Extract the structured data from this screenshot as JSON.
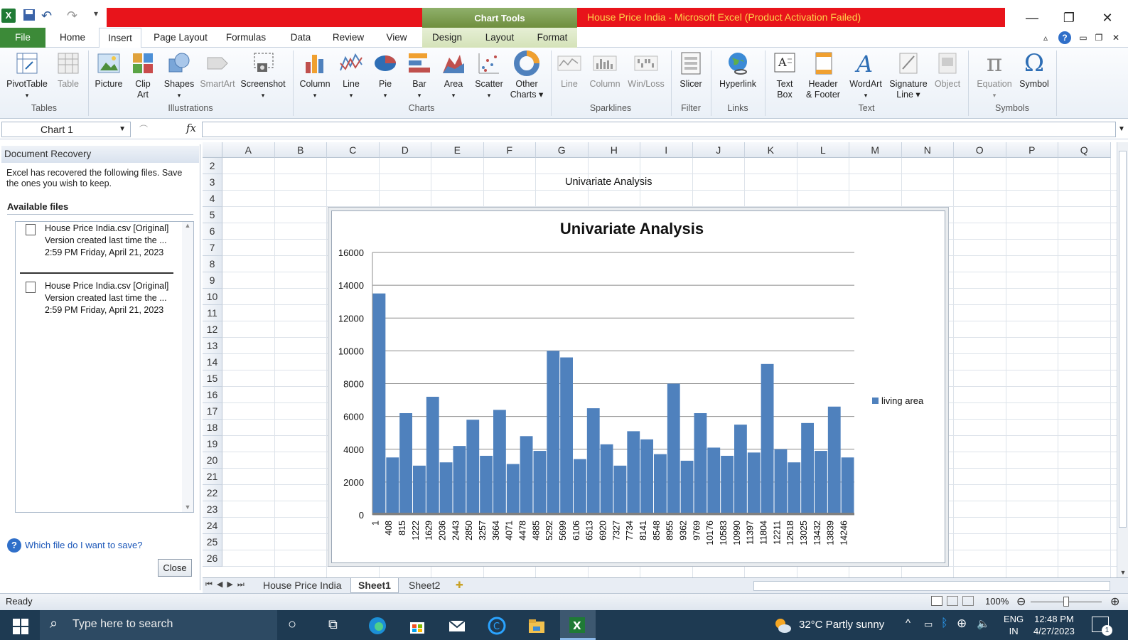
{
  "window": {
    "title": "House Price India  -  Microsoft Excel (Product Activation Failed)",
    "context_tab_group": "Chart Tools",
    "minimize": "—",
    "restore": "❐",
    "close": "✕"
  },
  "tabs": {
    "file": "File",
    "home": "Home",
    "insert": "Insert",
    "page_layout": "Page Layout",
    "formulas": "Formulas",
    "data": "Data",
    "review": "Review",
    "view": "View",
    "design": "Design",
    "layout": "Layout",
    "format": "Format"
  },
  "ribbon": {
    "pivottable": "PivotTable",
    "table": "Table",
    "picture": "Picture",
    "clip_art_1": "Clip",
    "clip_art_2": "Art",
    "shapes": "Shapes",
    "smartart": "SmartArt",
    "screenshot": "Screenshot",
    "column": "Column",
    "line": "Line",
    "pie": "Pie",
    "bar": "Bar",
    "area": "Area",
    "scatter": "Scatter",
    "other_charts_1": "Other",
    "other_charts_2": "Charts ▾",
    "spark_line": "Line",
    "spark_column": "Column",
    "spark_winloss": "Win/Loss",
    "slicer": "Slicer",
    "hyperlink": "Hyperlink",
    "text_box_1": "Text",
    "text_box_2": "Box",
    "header_footer_1": "Header",
    "header_footer_2": "& Footer",
    "wordart": "WordArt",
    "signature_1": "Signature",
    "signature_2": "Line ▾",
    "object": "Object",
    "equation": "Equation",
    "symbol": "Symbol",
    "groups": {
      "tables": "Tables",
      "illustrations": "Illustrations",
      "charts": "Charts",
      "sparklines": "Sparklines",
      "filter": "Filter",
      "links": "Links",
      "text": "Text",
      "symbols": "Symbols"
    }
  },
  "formula_bar": {
    "name_box": "Chart 1",
    "fx": "fx",
    "value": ""
  },
  "doc_recovery": {
    "title": "Document Recovery",
    "message": "Excel has recovered the following files.  Save the ones you wish to keep.",
    "available": "Available files",
    "files": [
      {
        "name": "House Price India.csv  [Original]",
        "desc": "Version created last time the ...",
        "time": "2:59 PM Friday, April 21, 2023"
      },
      {
        "name": "House Price India.csv  [Original]",
        "desc": "Version created last time the ...",
        "time": "2:59 PM Friday, April 21, 2023"
      }
    ],
    "help_link": "Which file do I want to save?",
    "close_button": "Close"
  },
  "grid": {
    "columns": [
      "A",
      "B",
      "C",
      "D",
      "E",
      "F",
      "G",
      "H",
      "I",
      "J",
      "K",
      "L",
      "M",
      "N",
      "O",
      "P",
      "Q"
    ],
    "rows": [
      "2",
      "3",
      "4",
      "5",
      "6",
      "7",
      "8",
      "9",
      "10",
      "11",
      "12",
      "13",
      "14",
      "15",
      "16",
      "17",
      "18",
      "19",
      "20",
      "21",
      "22",
      "23",
      "24",
      "25",
      "26"
    ],
    "cell_h3": "Univariate Analysis"
  },
  "chart_data": {
    "type": "bar",
    "title": "Univariate Analysis",
    "xlabel": "",
    "ylabel": "",
    "ylim": [
      0,
      16000
    ],
    "yticks": [
      0,
      2000,
      4000,
      6000,
      8000,
      10000,
      12000,
      14000,
      16000
    ],
    "categories": [
      "1",
      "408",
      "815",
      "1222",
      "1629",
      "2036",
      "2443",
      "2850",
      "3257",
      "3664",
      "4071",
      "4478",
      "4885",
      "5292",
      "5699",
      "6106",
      "6513",
      "6920",
      "7327",
      "7734",
      "8141",
      "8548",
      "8955",
      "9362",
      "9769",
      "10176",
      "10583",
      "10990",
      "11397",
      "11804",
      "12211",
      "12618",
      "13025",
      "13432",
      "13839",
      "14246"
    ],
    "series": [
      {
        "name": "living area",
        "color": "#4f81bd",
        "values": [
          13500,
          3500,
          6200,
          3000,
          7200,
          3200,
          4200,
          5800,
          3600,
          6400,
          3100,
          4800,
          3900,
          10000,
          9600,
          3400,
          6500,
          4300,
          3000,
          5100,
          4600,
          3700,
          8000,
          3300,
          6200,
          4100,
          3600,
          5500,
          3800,
          9200,
          4000,
          3200,
          5600,
          3900,
          6600,
          3500
        ]
      }
    ],
    "legend": "right",
    "grid": true
  },
  "sheet_tabs": {
    "sheets": [
      "House Price India",
      "Sheet1",
      "Sheet2"
    ],
    "active": "Sheet1"
  },
  "status": {
    "ready": "Ready",
    "zoom": "100%"
  },
  "taskbar": {
    "search_placeholder": "Type here to search",
    "weather": "32°C  Partly sunny",
    "lang_1": "ENG",
    "lang_2": "IN",
    "time": "12:48 PM",
    "date": "4/27/2023",
    "notif_count": "1"
  }
}
